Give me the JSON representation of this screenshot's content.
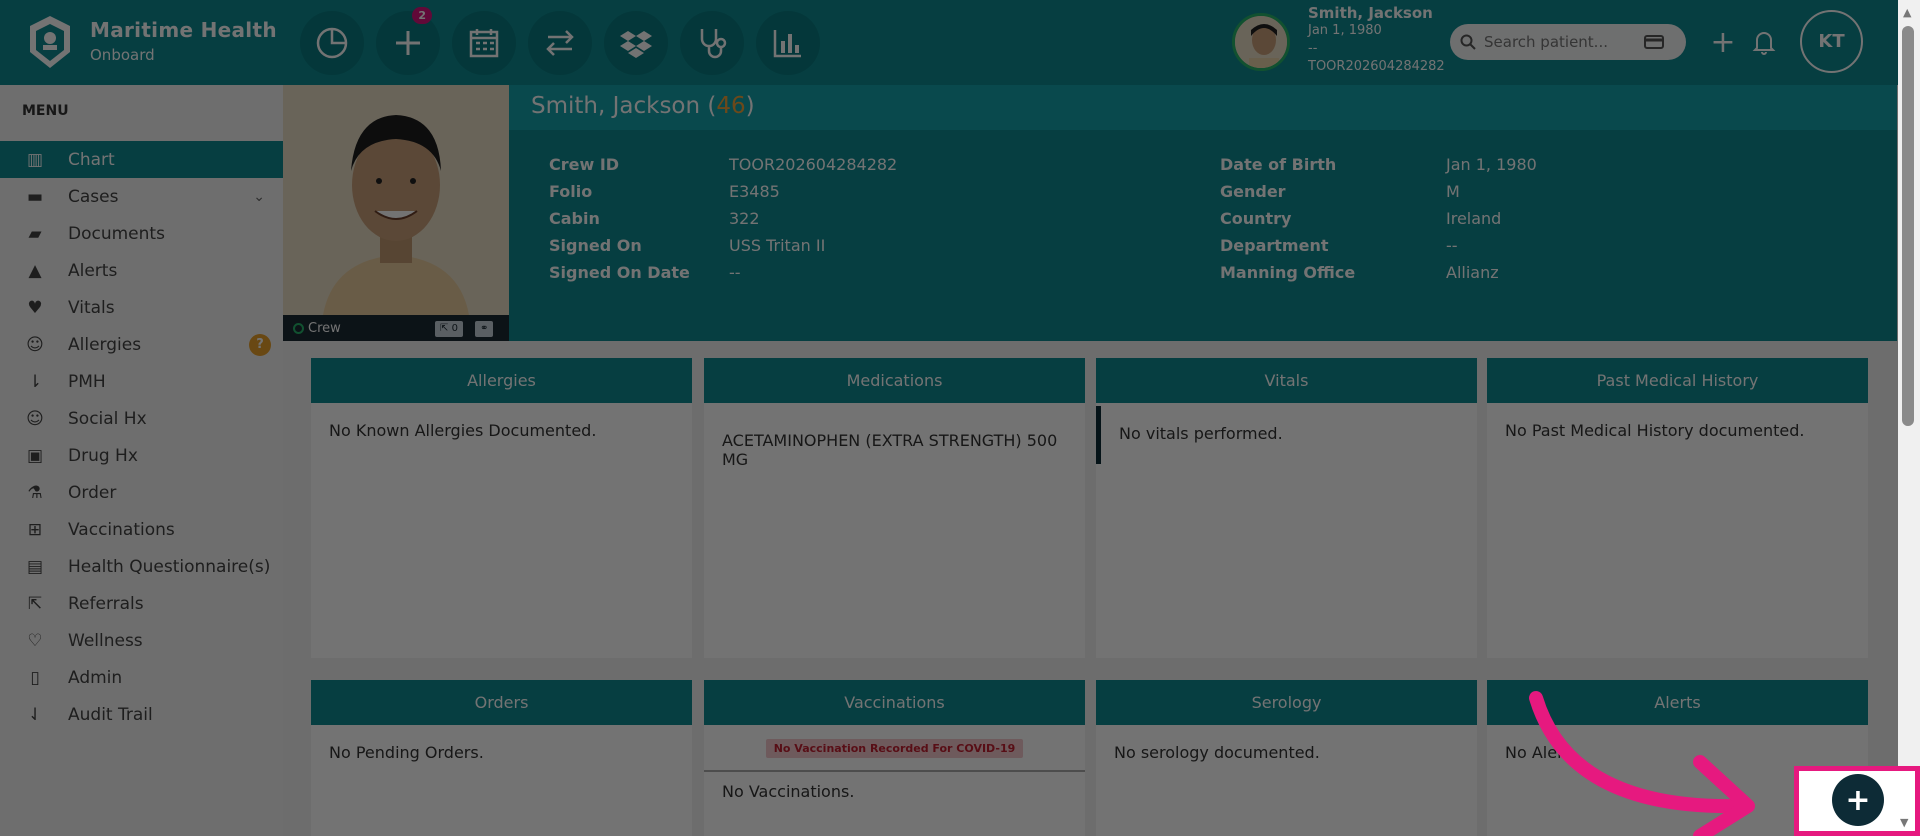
{
  "brand": {
    "title": "Maritime Health",
    "subtitle": "Onboard"
  },
  "nav": {
    "badge_count": "2"
  },
  "patient_header": {
    "name": "Smith, Jackson",
    "dob": "Jan 1, 1980",
    "dash": "--",
    "crew_id": "TOOR202604284282"
  },
  "search": {
    "placeholder": "Search patient..."
  },
  "user": {
    "initials": "KT"
  },
  "sidebar": {
    "menu_label": "MENU",
    "items": [
      {
        "label": "Chart"
      },
      {
        "label": "Cases"
      },
      {
        "label": "Documents"
      },
      {
        "label": "Alerts"
      },
      {
        "label": "Vitals"
      },
      {
        "label": "Allergies"
      },
      {
        "label": "PMH"
      },
      {
        "label": "Social Hx"
      },
      {
        "label": "Drug Hx"
      },
      {
        "label": "Order"
      },
      {
        "label": "Vaccinations"
      },
      {
        "label": "Health Questionnaire(s)"
      },
      {
        "label": "Referrals"
      },
      {
        "label": "Wellness"
      },
      {
        "label": "Admin"
      },
      {
        "label": "Audit Trail"
      }
    ],
    "allergies_badge": "?"
  },
  "photo": {
    "status": "Crew",
    "share_count": "0"
  },
  "profile": {
    "name": "Smith, Jackson",
    "age": "46",
    "left": [
      {
        "k": "Crew ID",
        "v": "TOOR202604284282"
      },
      {
        "k": "Folio",
        "v": "E3485"
      },
      {
        "k": "Cabin",
        "v": "322"
      },
      {
        "k": "Signed On",
        "v": "USS Tritan II"
      },
      {
        "k": "Signed On Date",
        "v": "--"
      }
    ],
    "right": [
      {
        "k": "Date of Birth",
        "v": "Jan 1, 1980"
      },
      {
        "k": "Gender",
        "v": "M"
      },
      {
        "k": "Country",
        "v": "Ireland"
      },
      {
        "k": "Department",
        "v": "--"
      },
      {
        "k": "Manning Office",
        "v": "Allianz"
      }
    ]
  },
  "cards": {
    "allergies": {
      "title": "Allergies",
      "body": "No Known Allergies Documented."
    },
    "medications": {
      "title": "Medications",
      "body": "ACETAMINOPHEN (EXTRA STRENGTH) 500 MG"
    },
    "vitals": {
      "title": "Vitals",
      "body": "No vitals performed."
    },
    "pmh": {
      "title": "Past Medical History",
      "body": "No Past Medical History documented."
    },
    "orders": {
      "title": "Orders",
      "body": "No Pending Orders."
    },
    "vaccinations": {
      "title": "Vaccinations",
      "covid": "No Vaccination Recorded For COVID-19",
      "body": "No Vaccinations."
    },
    "serology": {
      "title": "Serology",
      "body": "No serology documented."
    },
    "alerts": {
      "title": "Alerts",
      "body": "No Aler"
    }
  },
  "fab": {
    "label": "+"
  },
  "colors": {
    "primary": "#0e8a91",
    "highlight": "#e6197f",
    "fab": "#0d2b36"
  }
}
